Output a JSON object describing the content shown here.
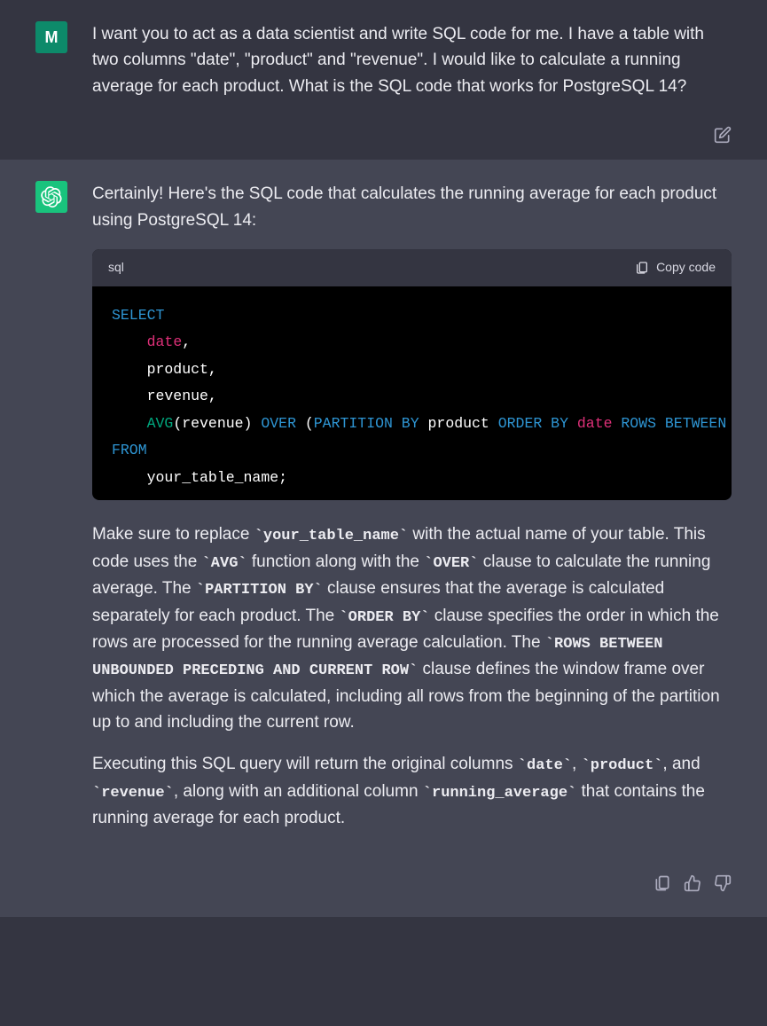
{
  "user": {
    "avatar_letter": "M",
    "message": "I want you to act as a data scientist and write SQL code for me. I have a table with two columns \"date\", \"product\" and \"revenue\". I would like to calculate a running average for each product. What is the SQL code that works for PostgreSQL 14?"
  },
  "assistant": {
    "intro": "Certainly! Here's the SQL code that calculates the running average for each product using PostgreSQL 14:",
    "code": {
      "language": "sql",
      "copy_label": "Copy code",
      "tokens": {
        "select": "SELECT",
        "date": "date",
        "comma1": ",",
        "product": "    product,",
        "revenue": "    revenue,",
        "avg": "AVG",
        "avg_arg_open": "(revenue) ",
        "over": "OVER",
        "partition_open": " (",
        "partition": "PARTITION",
        "by1": " BY",
        "prod": " product ",
        "order": "ORDER",
        "by2": " BY",
        "sp_date": " ",
        "date2": "date",
        "rows": " ROWS BETWEEN UNBOUNDED PRECEDING AND CURRENT ROW) AS running_average",
        "from": "FROM",
        "table": "    your_table_name;"
      }
    },
    "p2": {
      "t1": "Make sure to replace ",
      "c1": "`your_table_name`",
      "t2": " with the actual name of your table. This code uses the ",
      "c2": "`AVG`",
      "t3": " function along with the ",
      "c3": "`OVER`",
      "t4": " clause to calculate the running average. The ",
      "c4": "`PARTITION BY`",
      "t5": " clause ensures that the average is calculated separately for each product. The ",
      "c5": "`ORDER BY`",
      "t6": " clause specifies the order in which the rows are processed for the running average calculation. The ",
      "c6": "`ROWS BETWEEN UNBOUNDED PRECEDING AND CURRENT ROW`",
      "t7": " clause defines the window frame over which the average is calculated, including all rows from the beginning of the partition up to and including the current row."
    },
    "p3": {
      "t1": "Executing this SQL query will return the original columns ",
      "c1": "`date`",
      "t2": ", ",
      "c2": "`product`",
      "t3": ", and ",
      "c3": "`revenue`",
      "t4": ", along with an additional column ",
      "c4": "`running_average`",
      "t5": " that contains the running average for each product."
    }
  }
}
